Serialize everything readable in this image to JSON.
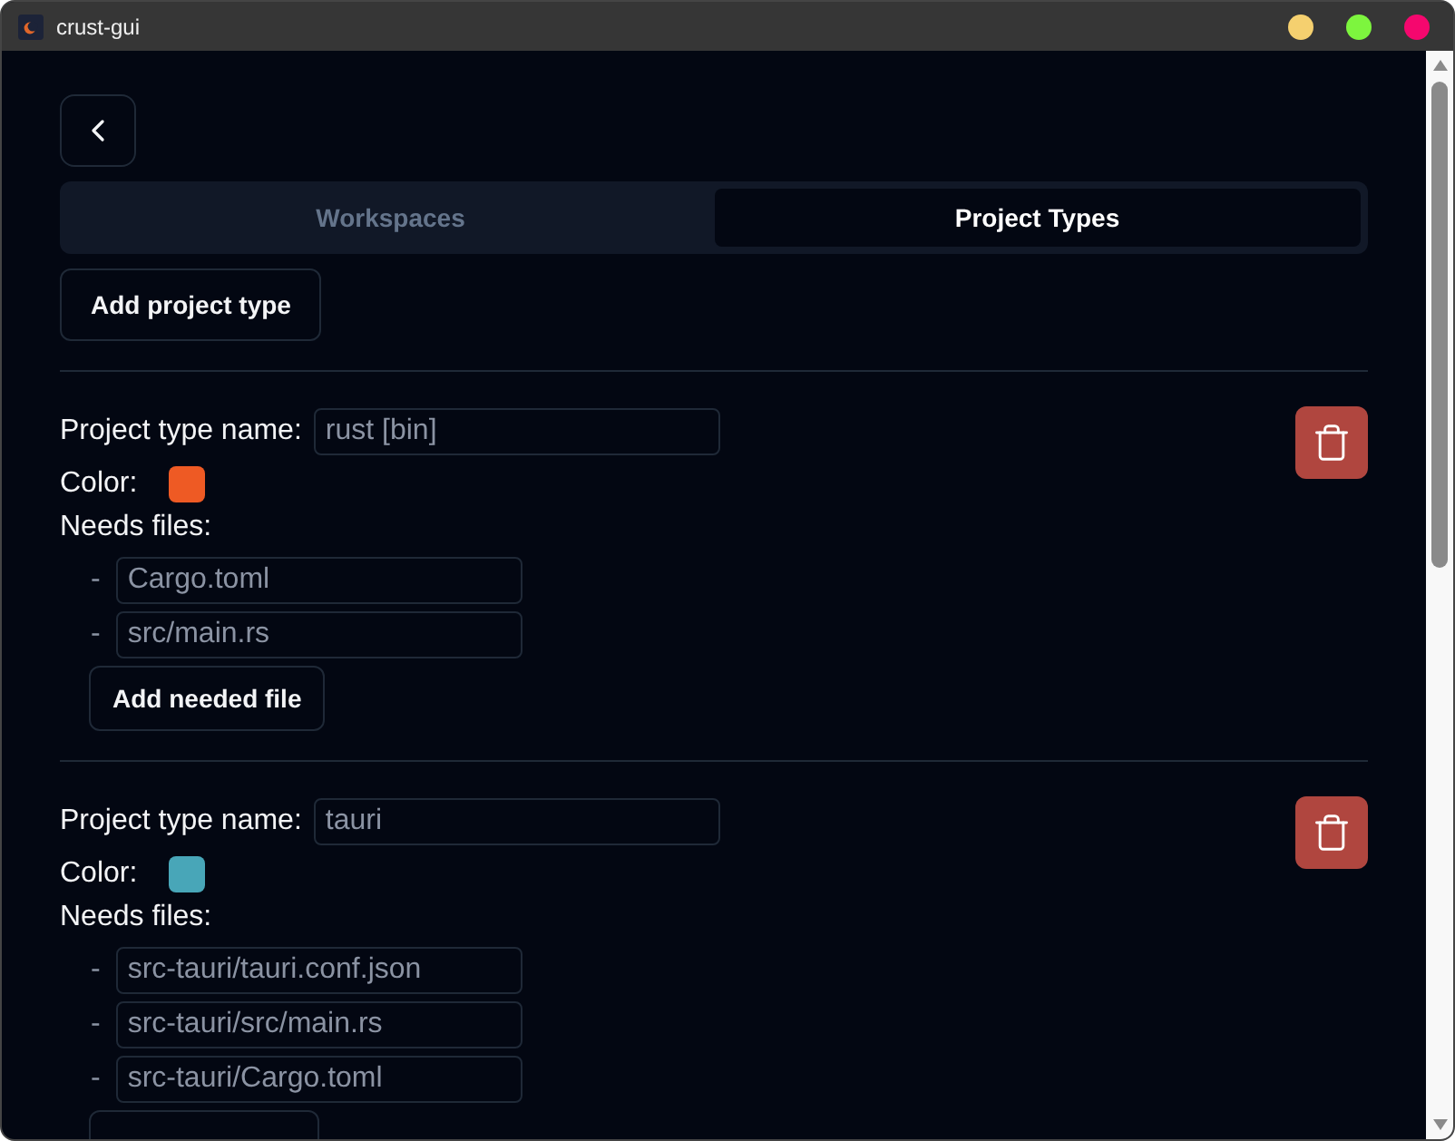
{
  "window": {
    "title": "crust-gui"
  },
  "tabs": [
    {
      "label": "Workspaces",
      "selected": false
    },
    {
      "label": "Project Types",
      "selected": true
    }
  ],
  "add_project_type_button": "Add project type",
  "project_types": [
    {
      "name_label": "Project type name:",
      "name": "rust [bin]",
      "color_label": "Color:",
      "color": "#ee5a24",
      "files_label": "Needs files:",
      "files": [
        {
          "bullet": "-",
          "value": "Cargo.toml"
        },
        {
          "bullet": "-",
          "value": "src/main.rs"
        }
      ],
      "add_file_button": "Add needed file"
    },
    {
      "name_label": "Project type name:",
      "name": "tauri",
      "color_label": "Color:",
      "color": "#48a6b8",
      "files_label": "Needs files:",
      "files": [
        {
          "bullet": "-",
          "value": "src-tauri/tauri.conf.json"
        },
        {
          "bullet": "-",
          "value": "src-tauri/src/main.rs"
        },
        {
          "bullet": "-",
          "value": "src-tauri/Cargo.toml"
        }
      ]
    }
  ]
}
